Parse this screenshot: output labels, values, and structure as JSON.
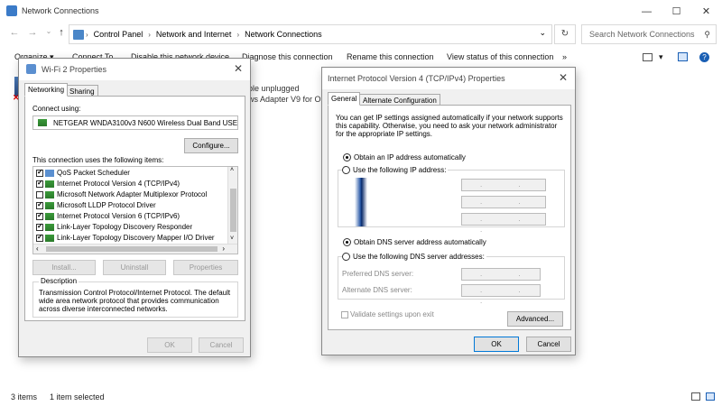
{
  "window": {
    "title": "Network Connections",
    "minimize": "—",
    "maximize": "☐",
    "close": "✕"
  },
  "address": {
    "crumbs": [
      "Control Panel",
      "Network and Internet",
      "Network Connections"
    ],
    "search_placeholder": "Search Network Connections"
  },
  "commands": {
    "organize": "Organize ▾",
    "connect_to": "Connect To",
    "disable": "Disable this network device",
    "diagnose": "Diagnose this connection",
    "rename": "Rename this connection",
    "view_status": "View status of this connection",
    "more": "»"
  },
  "background": {
    "line1": "ble unplugged",
    "line2": "ws Adapter V9 for Ope"
  },
  "status": {
    "count": "3 items",
    "selected": "1 item selected"
  },
  "wifi_dialog": {
    "title": "Wi-Fi 2 Properties",
    "tabs": [
      "Networking",
      "Sharing"
    ],
    "connect_using_label": "Connect using:",
    "adapter_name": "NETGEAR WNDA3100v3 N600 Wireless Dual Band USE",
    "configure": "Configure...",
    "items_label": "This connection uses the following items:",
    "items": [
      {
        "label": "QoS Packet Scheduler",
        "checked": true
      },
      {
        "label": "Internet Protocol Version 4 (TCP/IPv4)",
        "checked": true
      },
      {
        "label": "Microsoft Network Adapter Multiplexor Protocol",
        "checked": false
      },
      {
        "label": "Microsoft LLDP Protocol Driver",
        "checked": true
      },
      {
        "label": "Internet Protocol Version 6 (TCP/IPv6)",
        "checked": true
      },
      {
        "label": "Link-Layer Topology Discovery Responder",
        "checked": true
      },
      {
        "label": "Link-Layer Topology Discovery Mapper I/O Driver",
        "checked": true
      }
    ],
    "install": "Install...",
    "uninstall": "Uninstall",
    "properties": "Properties",
    "description_title": "Description",
    "description": "Transmission Control Protocol/Internet Protocol. The default wide area network protocol that provides communication across diverse interconnected networks.",
    "ok": "OK",
    "cancel": "Cancel"
  },
  "ipv4_dialog": {
    "title": "Internet Protocol Version 4 (TCP/IPv4) Properties",
    "tabs": [
      "General",
      "Alternate Configuration"
    ],
    "intro": "You can get IP settings assigned automatically if your network supports this capability. Otherwise, you need to ask your network administrator for the appropriate IP settings.",
    "obtain_ip": "Obtain an IP address automatically",
    "use_ip": "Use the following IP address:",
    "ip_dots": ". . .",
    "obtain_dns": "Obtain DNS server address automatically",
    "use_dns": "Use the following DNS server addresses:",
    "preferred_dns": "Preferred DNS server:",
    "alternate_dns": "Alternate DNS server:",
    "validate": "Validate settings upon exit",
    "advanced": "Advanced...",
    "ok": "OK",
    "cancel": "Cancel"
  }
}
